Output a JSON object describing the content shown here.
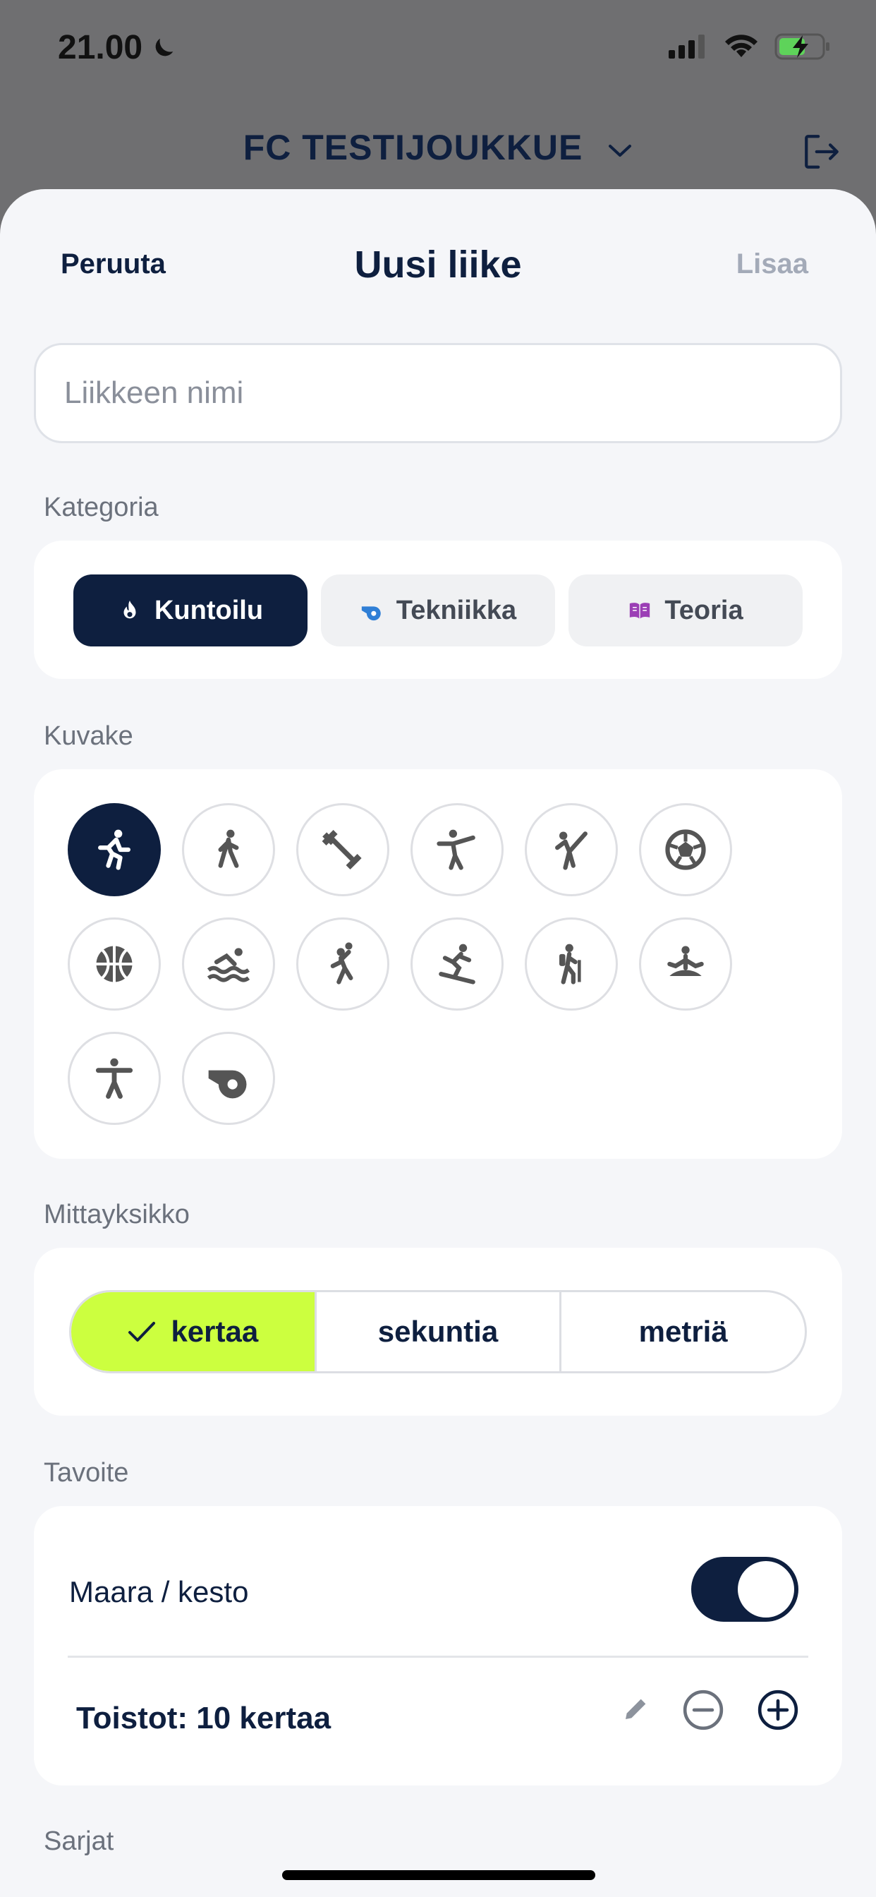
{
  "status_bar": {
    "time": "21.00"
  },
  "header": {
    "team_name": "FC TESTIJOUKKUE"
  },
  "sheet": {
    "cancel_label": "Peruuta",
    "title": "Uusi liike",
    "add_label": "Lisaa",
    "name_placeholder": "Liikkeen nimi"
  },
  "category": {
    "label": "Kategoria",
    "options": [
      {
        "label": "Kuntoilu",
        "icon": "flame-icon",
        "selected": true
      },
      {
        "label": "Tekniikka",
        "icon": "whistle-icon",
        "selected": false,
        "color": "#2f7fd6"
      },
      {
        "label": "Teoria",
        "icon": "book-icon",
        "selected": false,
        "color": "#9b3fb5"
      }
    ]
  },
  "icons": {
    "label": "Kuvake",
    "items": [
      "running-icon",
      "walking-icon",
      "dumbbell-icon",
      "martial-arts-icon",
      "kick-icon",
      "soccer-ball-icon",
      "basketball-icon",
      "swimming-icon",
      "handball-icon",
      "snowboarding-icon",
      "hiking-icon",
      "meditation-icon",
      "accessibility-icon",
      "whistle-icon"
    ],
    "selected_index": 0
  },
  "unit": {
    "label": "Mittayksikko",
    "options": [
      "kertaa",
      "sekuntia",
      "metriä"
    ],
    "selected": "kertaa"
  },
  "goal": {
    "label": "Tavoite",
    "toggle_label": "Maara / kesto",
    "toggle_on": true,
    "reps_text": "Toistot: 10 kertaa"
  },
  "sets": {
    "label": "Sarjat"
  },
  "colors": {
    "navy": "#0e1f3f",
    "accent": "#ccff3f"
  }
}
